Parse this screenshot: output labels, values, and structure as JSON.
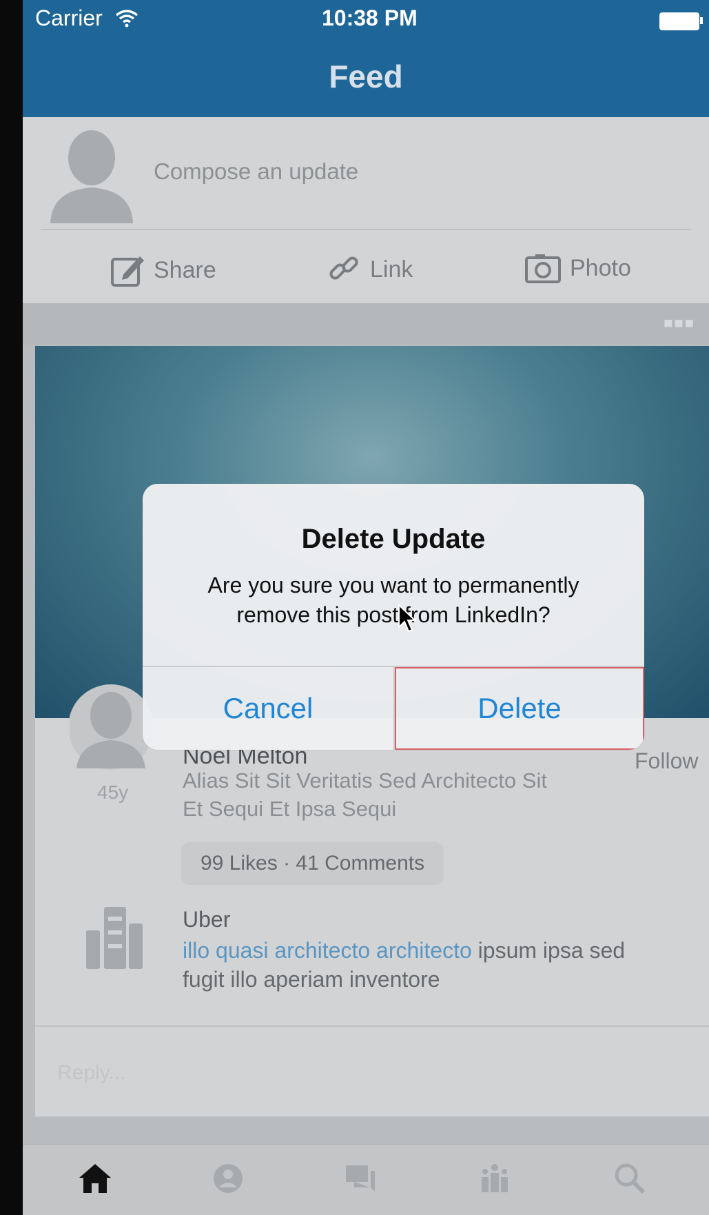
{
  "status_bar": {
    "carrier": "Carrier",
    "time": "10:38 PM"
  },
  "header": {
    "title": "Feed"
  },
  "compose": {
    "placeholder": "Compose an update",
    "actions": {
      "share": "Share",
      "link": "Link",
      "photo": "Photo"
    }
  },
  "post": {
    "author_name": "Noel Melton",
    "author_headline": "Alias Sit Sit Veritatis Sed Architecto Sit Et Sequi Et Ipsa Sequi",
    "age": "45y",
    "follow_label": "Follow",
    "stats": "99 Likes · 41 Comments",
    "comment": {
      "company": "Uber",
      "link_text": "illo quasi architecto architecto",
      "text": " ipsum ipsa sed fugit illo aperiam inventore"
    },
    "reply_placeholder": "Reply..."
  },
  "dialog": {
    "title": "Delete Update",
    "message": "Are you sure you want to permanently remove this post from LinkedIn?",
    "cancel_label": "Cancel",
    "delete_label": "Delete"
  },
  "tabbar": {
    "items": [
      "home-icon",
      "profile-icon",
      "messages-icon",
      "network-icon",
      "search-icon"
    ]
  },
  "colors": {
    "header": "#1f6698",
    "dialog_button": "#1f86d6",
    "link": "#5a96c2"
  }
}
